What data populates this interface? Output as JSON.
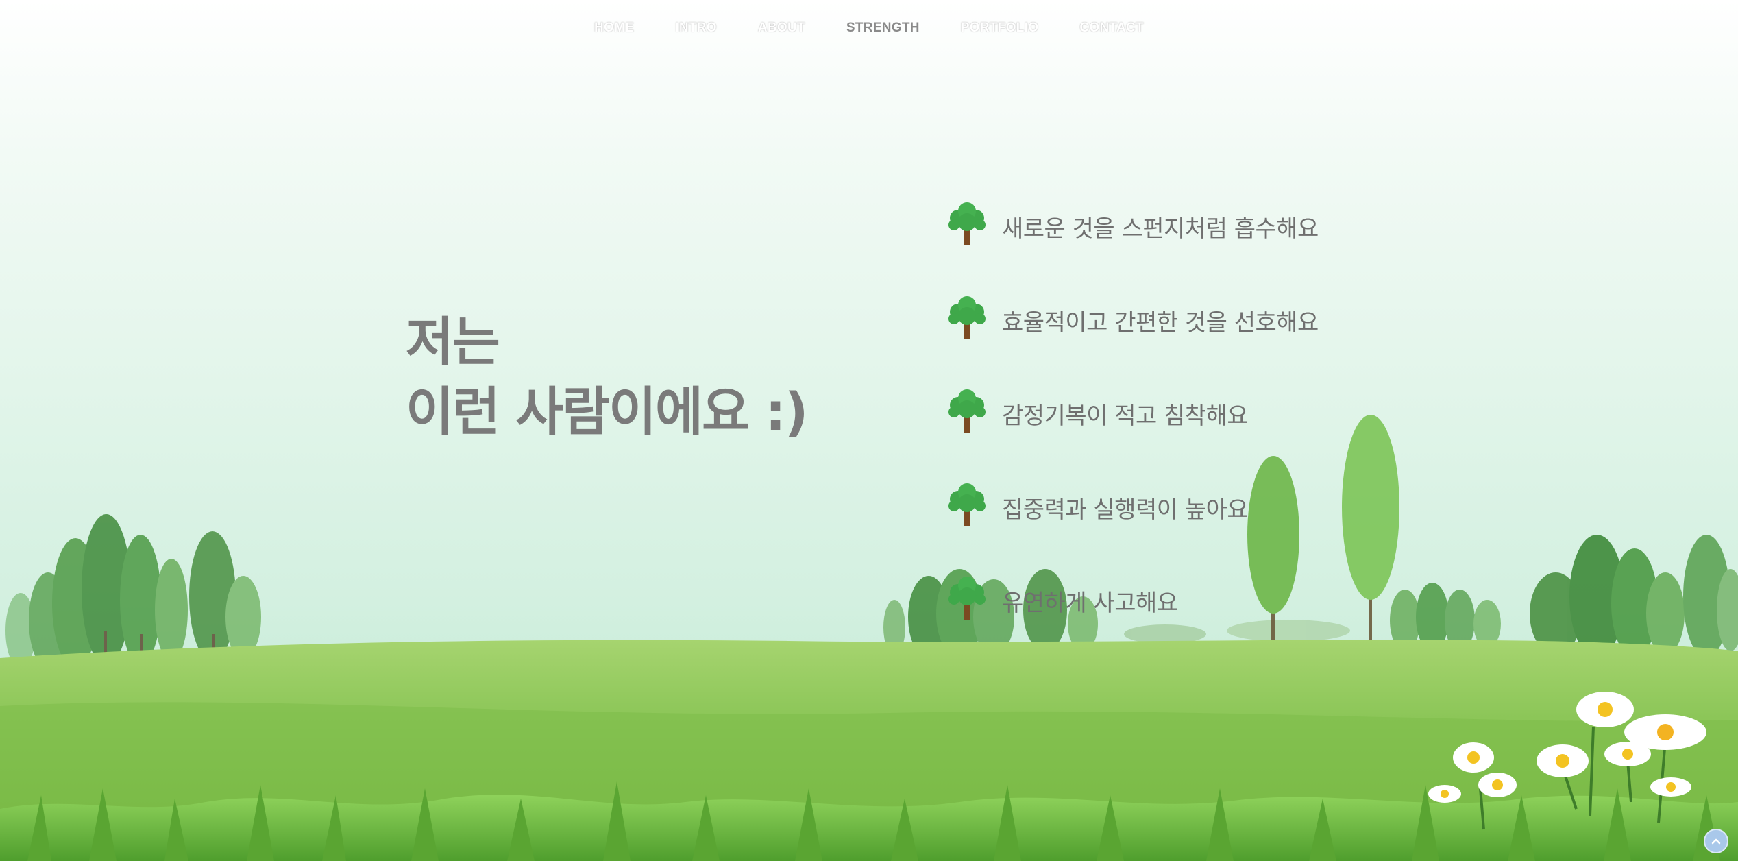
{
  "nav": {
    "items": [
      {
        "label": "HOME",
        "active": false
      },
      {
        "label": "INTRO",
        "active": false
      },
      {
        "label": "ABOUT",
        "active": false
      },
      {
        "label": "STRENGTH",
        "active": true
      },
      {
        "label": "PORTFOLIO",
        "active": false
      },
      {
        "label": "CONTACT",
        "active": false
      }
    ]
  },
  "headline": {
    "line1": "저는",
    "line2": "이런 사람이에요 :)"
  },
  "strengths": [
    {
      "icon": "tree-icon",
      "text": "새로운 것을 스펀지처럼 흡수해요"
    },
    {
      "icon": "tree-icon",
      "text": "효율적이고 간편한 것을 선호해요"
    },
    {
      "icon": "tree-icon",
      "text": "감정기복이 적고 침착해요"
    },
    {
      "icon": "tree-icon",
      "text": "집중력과 실행력이 높아요"
    },
    {
      "icon": "tree-icon",
      "text": "유연하게 사고해요"
    }
  ],
  "scroll_top": {
    "icon": "chevron-up-icon"
  },
  "colors": {
    "heading": "#7a7a7a",
    "text": "#6f6f6f",
    "tree_leaf": "#3fa84a",
    "tree_trunk": "#7b4a22",
    "grass": "#7cc24f",
    "sky_bottom": "#cdeedc"
  }
}
